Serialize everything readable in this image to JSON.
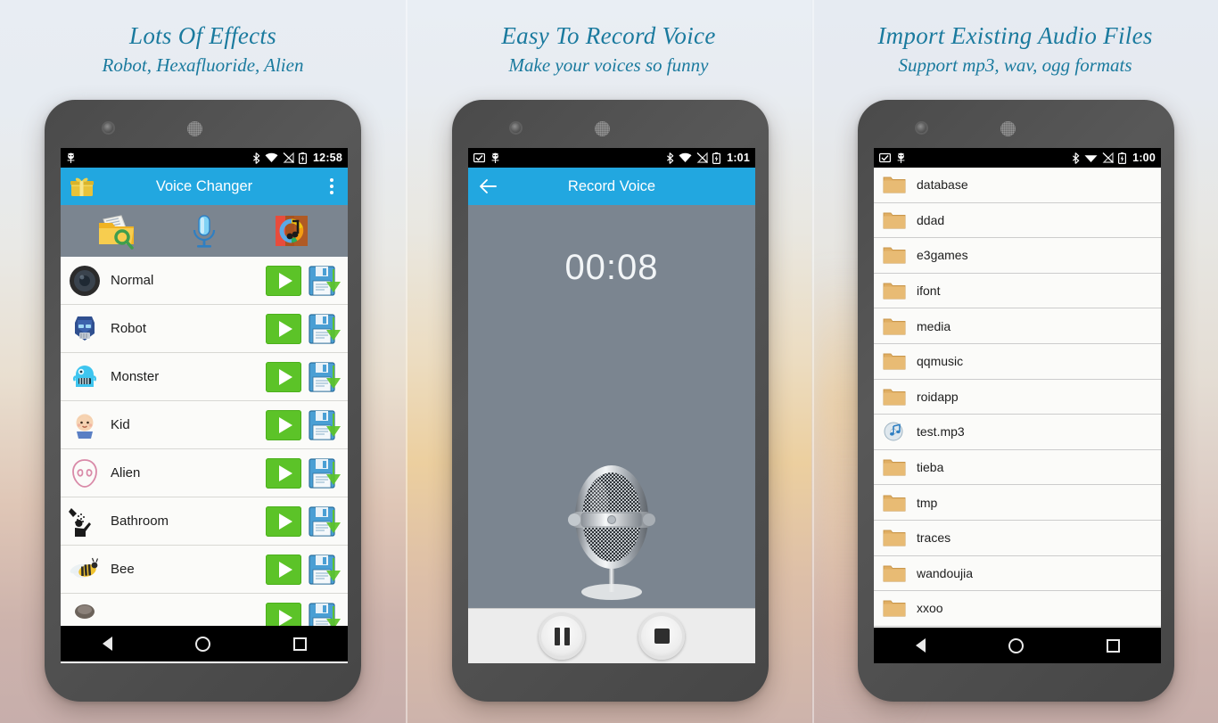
{
  "panels": [
    {
      "title": "Lots Of Effects",
      "subtitle": "Robot, Hexafluoride, Alien"
    },
    {
      "title": "Easy To Record Voice",
      "subtitle": "Make your voices so funny"
    },
    {
      "title": "Import Existing Audio Files",
      "subtitle": "Support mp3, wav, ogg formats"
    }
  ],
  "colors": {
    "accent_blue": "#22a7e0",
    "heading_teal": "#1a7a9e",
    "play_green": "#5cc328",
    "save_blue": "#3b8fc4",
    "screen_gray": "#7b8590",
    "folder_tan": "#e0ae62"
  },
  "phone1": {
    "status": {
      "time": "12:58",
      "icons": [
        "android-icon",
        "bluetooth-icon",
        "wifi-icon",
        "signal-off-icon",
        "battery-charging-icon"
      ]
    },
    "appbar": {
      "title": "Voice Changer",
      "left_icon": "gift-icon",
      "right_icon": "overflow-menu-icon"
    },
    "toolbar": [
      {
        "name": "open-file-icon"
      },
      {
        "name": "record-mic-icon"
      },
      {
        "name": "media-player-icon"
      }
    ],
    "effects": [
      {
        "label": "Normal",
        "thumb": "speaker-icon"
      },
      {
        "label": "Robot",
        "thumb": "robot-icon"
      },
      {
        "label": "Monster",
        "thumb": "monster-icon"
      },
      {
        "label": "Kid",
        "thumb": "kid-icon"
      },
      {
        "label": "Alien",
        "thumb": "alien-icon"
      },
      {
        "label": "Bathroom",
        "thumb": "shower-icon"
      },
      {
        "label": "Bee",
        "thumb": "bee-icon"
      },
      {
        "label": "",
        "thumb": "partial-icon"
      }
    ],
    "row_actions": {
      "play": "play-button",
      "save": "save-button"
    },
    "nav": [
      "back-button",
      "home-button",
      "recents-button"
    ]
  },
  "phone2": {
    "status": {
      "time": "1:01",
      "icons": [
        "screenshot-icon",
        "android-icon",
        "bluetooth-icon",
        "wifi-icon",
        "signal-off-icon",
        "battery-charging-icon"
      ]
    },
    "appbar": {
      "title": "Record Voice",
      "left_icon": "back-arrow-icon"
    },
    "timer": "00:08",
    "mic": "microphone-image",
    "controls": [
      {
        "name": "pause-button"
      },
      {
        "name": "stop-button"
      }
    ],
    "nav": [
      "back-button",
      "home-button",
      "recents-button"
    ]
  },
  "phone3": {
    "status": {
      "time": "1:00",
      "icons": [
        "screenshot-icon",
        "android-icon",
        "bluetooth-icon",
        "wifi-icon",
        "signal-off-icon",
        "battery-charging-icon"
      ]
    },
    "files": [
      {
        "label": "database",
        "type": "folder"
      },
      {
        "label": "ddad",
        "type": "folder"
      },
      {
        "label": "e3games",
        "type": "folder"
      },
      {
        "label": "ifont",
        "type": "folder"
      },
      {
        "label": "media",
        "type": "folder"
      },
      {
        "label": "qqmusic",
        "type": "folder"
      },
      {
        "label": "roidapp",
        "type": "folder"
      },
      {
        "label": "test.mp3",
        "type": "audio"
      },
      {
        "label": "tieba",
        "type": "folder"
      },
      {
        "label": "tmp",
        "type": "folder"
      },
      {
        "label": "traces",
        "type": "folder"
      },
      {
        "label": "wandoujia",
        "type": "folder"
      },
      {
        "label": "xxoo",
        "type": "folder"
      }
    ],
    "nav": [
      "back-button",
      "home-button",
      "recents-button"
    ]
  }
}
